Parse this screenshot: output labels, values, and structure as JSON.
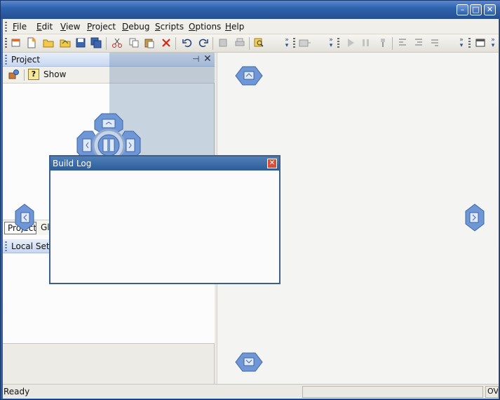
{
  "window": {
    "title": "",
    "minimize_glyph": "–",
    "maximize_glyph": "□",
    "close_glyph": "✕"
  },
  "menubar": {
    "items": [
      {
        "pre": "",
        "ul": "F",
        "post": "ile"
      },
      {
        "pre": "",
        "ul": "E",
        "post": "dit"
      },
      {
        "pre": "",
        "ul": "V",
        "post": "iew"
      },
      {
        "pre": "",
        "ul": "P",
        "post": "roject"
      },
      {
        "pre": "",
        "ul": "D",
        "post": "ebug"
      },
      {
        "pre": "",
        "ul": "S",
        "post": "cripts"
      },
      {
        "pre": "",
        "ul": "O",
        "post": "ptions"
      },
      {
        "pre": "",
        "ul": "H",
        "post": "elp"
      }
    ]
  },
  "toolbar": {
    "icons": [
      "new-project-icon",
      "new-file-icon",
      "open-folder-icon",
      "open-icon",
      "save-icon",
      "save-all-icon",
      "cut-icon",
      "copy-icon",
      "paste-icon",
      "delete-icon",
      "undo-icon",
      "redo-icon",
      "build-icon",
      "print-icon",
      "find-icon",
      "run-icon",
      "pause-icon",
      "debug-icon",
      "step-into-icon",
      "step-over-icon",
      "step-out-icon",
      "window-icon"
    ]
  },
  "project_pane": {
    "title": "Project",
    "pin_glyph": "⊣",
    "close_glyph": "✕",
    "show_label": "Show",
    "help_glyph": "?",
    "tabs": {
      "active": "Project",
      "other": "Globals"
    },
    "local_settings_title": "Local Settings"
  },
  "build_log": {
    "title": "Build Log",
    "close_glyph": "✕"
  },
  "status": {
    "ready": "Ready",
    "panel3": "OVR"
  },
  "colors": {
    "accent": "#2f63ad",
    "dock_blue": "#6f97d6"
  }
}
